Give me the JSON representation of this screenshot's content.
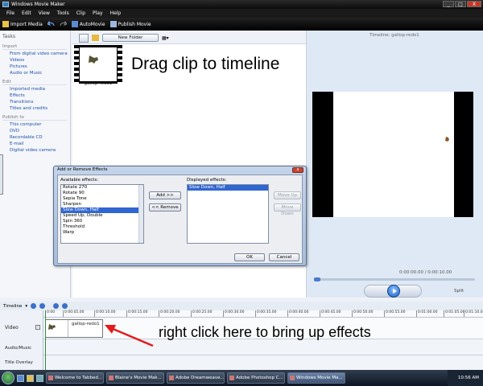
{
  "window": {
    "title": "Windows Movie Maker",
    "controls": [
      "_",
      "□",
      "X"
    ]
  },
  "menu": [
    "File",
    "Edit",
    "View",
    "Tools",
    "Clip",
    "Play",
    "Help"
  ],
  "toolbar": {
    "import_media": "Import Media",
    "automovie": "AutoMovie",
    "publish_movie": "Publish Movie"
  },
  "tasks": {
    "heading": "Tasks",
    "sections": [
      {
        "title": "Import",
        "links": [
          "From digital video camera",
          "Videos",
          "Pictures",
          "Audio or Music"
        ]
      },
      {
        "title": "Edit",
        "links": [
          "Imported media",
          "Effects",
          "Transitions",
          "Titles and credits"
        ]
      },
      {
        "title": "Publish to",
        "links": [
          "This computer",
          "DVD",
          "Recordable CD",
          "E-mail",
          "Digital video camera"
        ]
      }
    ]
  },
  "collection": {
    "new_folder_label": "New Folder",
    "clip_name": "gallop-redo1"
  },
  "annotations": {
    "drag": "Drag clip to timeline",
    "right_click": "right click here to bring up effects"
  },
  "preview": {
    "title": "Timeline: gallop-redo1",
    "time": "0:00:00.00 / 0:00:10.00",
    "split_label": "Split"
  },
  "dialog": {
    "title": "Add or Remove Effects",
    "available_label": "Available effects:",
    "available": [
      "Rotate 270",
      "Rotate 90",
      "Sepia Tone",
      "Sharpen",
      "Slow Down, Half",
      "Speed Up, Double",
      "Spin 360",
      "Threshold",
      "Warp"
    ],
    "available_selected": "Slow Down, Half",
    "displayed_label": "Displayed effects:",
    "displayed": [
      "Slow Down, Half"
    ],
    "add_button": "Add >>",
    "remove_button": "<< Remove",
    "move_up": "Move Up",
    "move_down": "Move Down",
    "ok": "OK",
    "cancel": "Cancel"
  },
  "timeline": {
    "label": "Timeline",
    "ticks": [
      "0:00",
      "0:00:05.00",
      "0:00:10.00",
      "0:00:15.00",
      "0:00:20.00",
      "0:00:25.00",
      "0:00:30.00",
      "0:00:35.00",
      "0:00:40.00",
      "0:00:45.00",
      "0:00:50.00",
      "0:00:55.00",
      "0:01:00.00",
      "0:01:05.00",
      "0:01:10.00"
    ],
    "tracks": {
      "video": "Video",
      "audio": "Audio/Music",
      "overlay": "Title Overlay"
    },
    "clip_name": "gallop-redo1"
  },
  "taskbar": {
    "buttons": [
      "Welcome to Tabbed...",
      "Blaine's Movie Mak...",
      "Adobe Dreamweave...",
      "Adobe Photoshop C...",
      "Windows Movie Ma..."
    ],
    "active_index": 4,
    "clock": "10:56 AM"
  }
}
